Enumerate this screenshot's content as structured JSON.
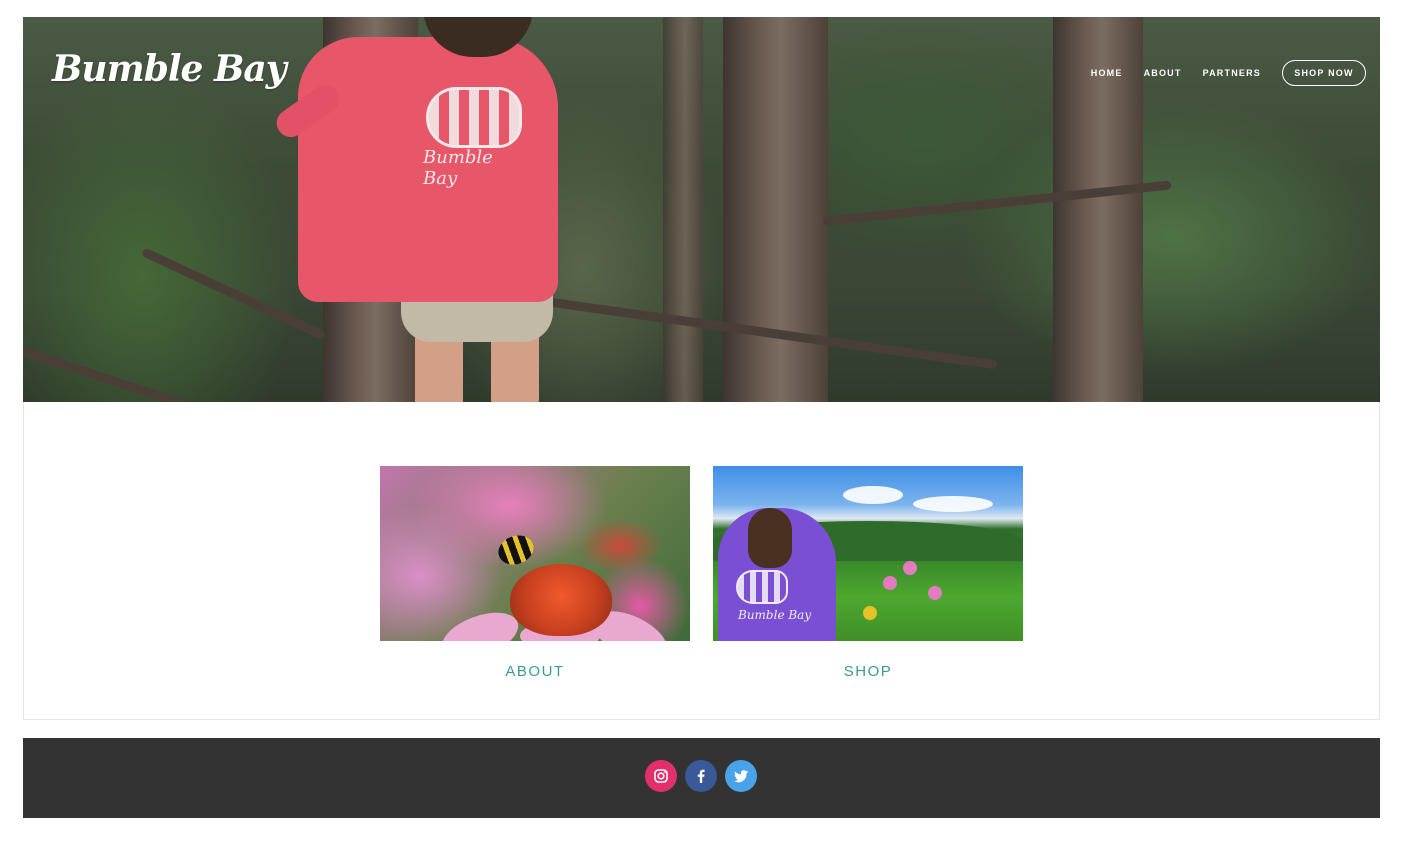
{
  "header": {
    "logo_text": "Bumble Bay",
    "nav": [
      {
        "label": "HOME"
      },
      {
        "label": "ABOUT"
      },
      {
        "label": "PARTNERS"
      }
    ],
    "cta_label": "SHOP NOW"
  },
  "hero": {
    "shirt_text": "Bumble Bay"
  },
  "tiles": [
    {
      "caption": "ABOUT"
    },
    {
      "caption": "SHOP"
    }
  ],
  "shop_image": {
    "shirt_text": "Bumble Bay"
  },
  "footer": {
    "social": [
      {
        "icon": "instagram-icon",
        "color": "#e1306c"
      },
      {
        "icon": "facebook-icon",
        "color": "#3b5998"
      },
      {
        "icon": "twitter-icon",
        "color": "#4aa3ea"
      }
    ]
  },
  "colors": {
    "accent": "#3c9a91",
    "footer_bg": "#333333"
  }
}
